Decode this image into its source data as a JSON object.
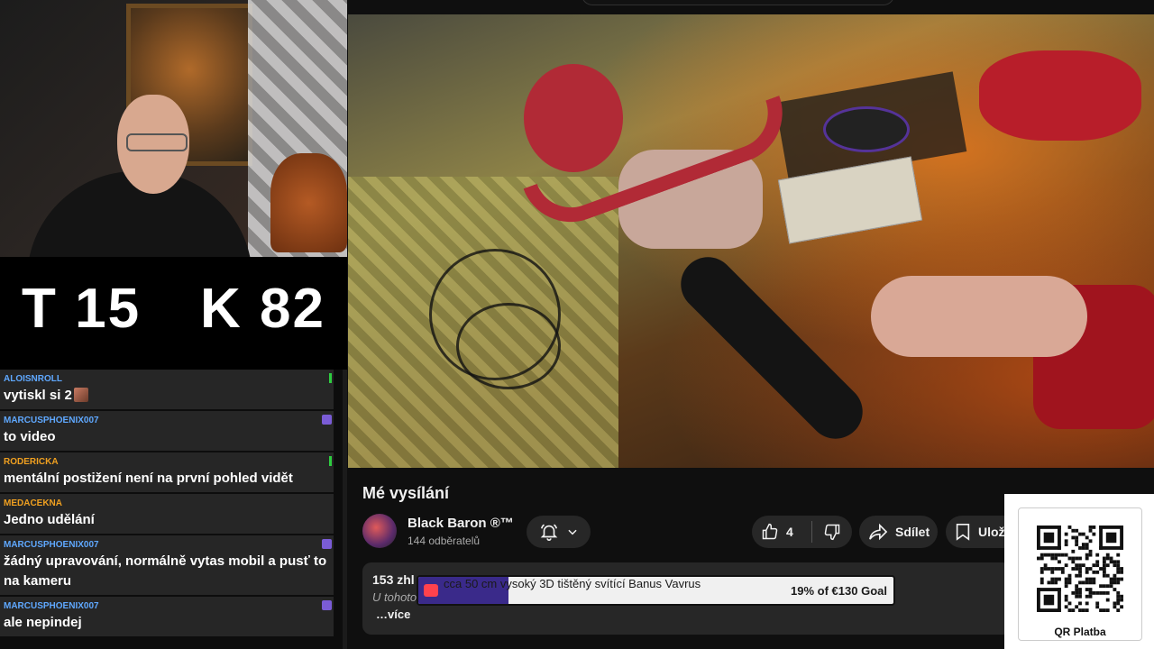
{
  "scoreboard": {
    "t_label": "T 15",
    "k_label": "K 82"
  },
  "chat": {
    "messages": [
      {
        "user": "ALOISNROLL",
        "text": "vytiskl si 2",
        "user_color": "#5fa8ff",
        "emote": true,
        "badge": "green"
      },
      {
        "user": "MARCUSPHOENIX007",
        "text": "to video",
        "user_color": "#5fa8ff",
        "badge": "purple"
      },
      {
        "user": "RODERICKA",
        "text": "mentální postižení není na první pohled vidět",
        "user_color": "#f0a020",
        "badge": "green"
      },
      {
        "user": "MEDACEKNA",
        "text": "Jedno udělání",
        "user_color": "#f0a020",
        "badge": "none"
      },
      {
        "user": "MARCUSPHOENIX007",
        "text": "žádný upravování, normálně vytas mobil a pusť to na kameru",
        "user_color": "#5fa8ff",
        "badge": "purple"
      },
      {
        "user": "MARCUSPHOENIX007",
        "text": "ale nepindej",
        "user_color": "#5fa8ff",
        "badge": "purple"
      }
    ]
  },
  "video": {
    "title": "Mé vysílání",
    "channel_name": "Black Baron ®™",
    "subscribers": "144 odběratelů",
    "like_count": "4",
    "share_label": "Sdílet",
    "save_label": "Ulož",
    "description": {
      "views": "153 zhl",
      "preview": "U tohoto",
      "more": "…více"
    }
  },
  "goal": {
    "title": "cca 50 cm vysoký 3D tištěný svítící Banus Vavrus",
    "amount": "19% of €130 Goal",
    "progress": 0.19,
    "fill_color": "#3a2a8a"
  },
  "qr": {
    "label": "QR Platba"
  },
  "icons": {
    "bell": "bell-icon",
    "chevron": "chevron-down-icon",
    "like": "thumbs-up-icon",
    "dislike": "thumbs-down-icon",
    "share": "share-icon",
    "save": "bookmark-icon",
    "patreon": "patreon-icon"
  }
}
